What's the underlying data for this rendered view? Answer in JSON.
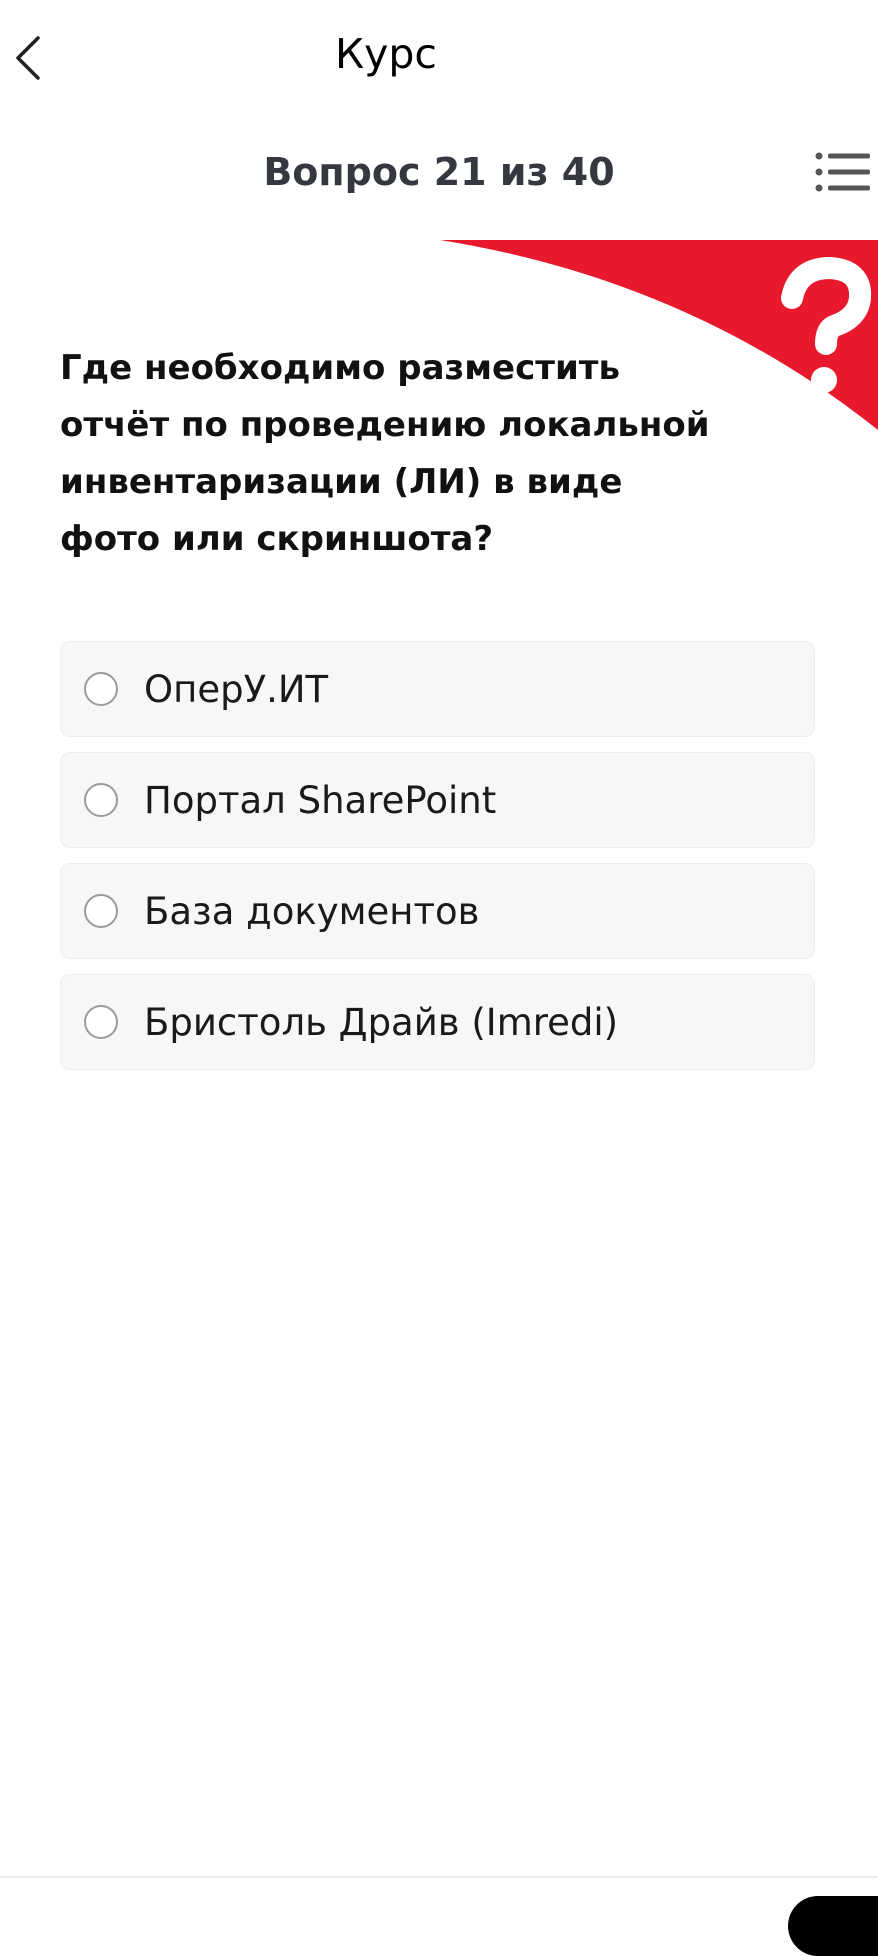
{
  "header": {
    "title": "Курс",
    "back_icon": "chevron-left-icon"
  },
  "progress": {
    "label": "Вопрос 21 из 40",
    "current": 21,
    "total": 40,
    "list_icon": "list-icon"
  },
  "banner": {
    "color": "#e8192c",
    "icon": "question-mark-icon"
  },
  "question": {
    "lines": [
      "Где необходимо разместить",
      "отчёт по проведению локальной",
      "инвентаризации (ЛИ) в виде",
      "фото или скриншота?"
    ]
  },
  "options": [
    {
      "label": "ОперУ.ИТ",
      "selected": false
    },
    {
      "label": "Портал SharePoint",
      "selected": false
    },
    {
      "label": "База документов",
      "selected": false
    },
    {
      "label": "Бристоль Драйв (Imredi)",
      "selected": false
    }
  ]
}
